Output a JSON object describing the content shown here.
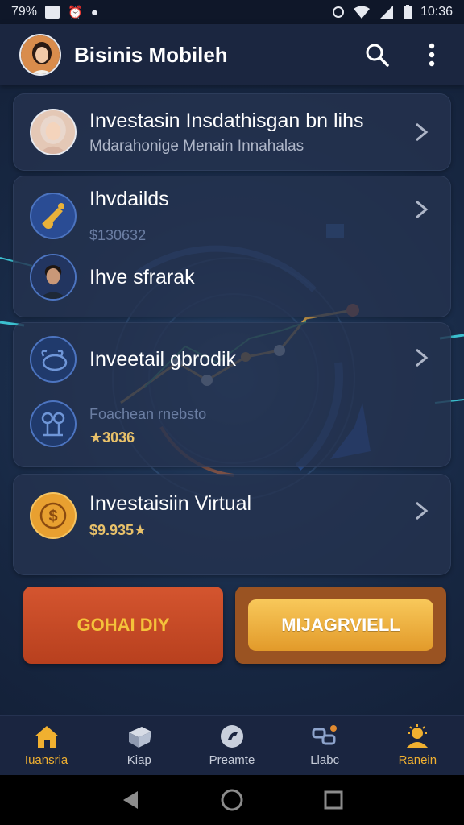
{
  "status_bar": {
    "left_text": "79%",
    "time": "10:36"
  },
  "header": {
    "title": "Bisinis Mobileh",
    "search_icon": "search-icon",
    "menu_icon": "more-vert-icon"
  },
  "cards": [
    {
      "rows": [
        {
          "title": "Investasin Insdathisgan bn lihs",
          "subtitle": "Mdarahonige Menain Innahalas",
          "icon": "woman-avatar"
        }
      ]
    },
    {
      "rows": [
        {
          "title": "Ihvdailds",
          "subtitle": "$130632",
          "icon": "trumpet-icon"
        },
        {
          "title": "Ihve sfrarak",
          "icon": "man-avatar"
        }
      ]
    },
    {
      "rows": [
        {
          "title": "Inveetail gbrodik",
          "icon": "bull-icon"
        },
        {
          "subtitle": "Foachean rnebsto",
          "amount": "★3036",
          "icon": "tools-icon"
        }
      ]
    },
    {
      "rows": [
        {
          "title": "Investaisiin Virtual",
          "amount": "$9.935★",
          "icon": "coin-icon"
        }
      ]
    }
  ],
  "buttons": {
    "left_label": "GOHAI DIY",
    "right_label": "MIJAGRVIELL"
  },
  "bottom_nav": [
    {
      "label": "Iuansria",
      "icon": "home-icon",
      "active": true
    },
    {
      "label": "Kiap",
      "icon": "cube-icon",
      "active": false
    },
    {
      "label": "Preamte",
      "icon": "phone-icon",
      "active": false
    },
    {
      "label": "Llabc",
      "icon": "link-icon",
      "active": false
    },
    {
      "label": "Ranein",
      "icon": "profile-icon",
      "active": true
    }
  ],
  "colors": {
    "accent": "#f0b030",
    "button_red": "#c44a25",
    "button_gold": "#f2b540",
    "background": "#172742"
  }
}
